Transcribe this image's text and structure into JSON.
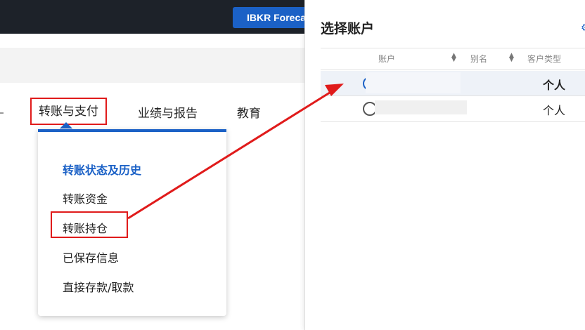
{
  "topbar": {
    "forecast_button": "IBKR Foreca"
  },
  "nav": {
    "tabs": [
      {
        "label": "转账与支付",
        "active": true
      },
      {
        "label": "业绩与报告"
      },
      {
        "label": "教育"
      }
    ]
  },
  "dropdown": {
    "items": [
      {
        "label": "转账状态及历史",
        "active": true
      },
      {
        "label": "转账资金"
      },
      {
        "label": "转账持仓",
        "highlighted": true
      },
      {
        "label": "已保存信息"
      },
      {
        "label": "直接存款/取款"
      }
    ]
  },
  "panel": {
    "title": "选择账户",
    "columns": [
      "账户",
      "别名",
      "客户类型"
    ],
    "rows": [
      {
        "selected": true,
        "customer_type": "个人"
      },
      {
        "selected": false,
        "customer_type": "个人"
      }
    ]
  },
  "colors": {
    "accent": "#1b61c6",
    "annotation_red": "#e01b1b",
    "topbar": "#1d2229"
  }
}
